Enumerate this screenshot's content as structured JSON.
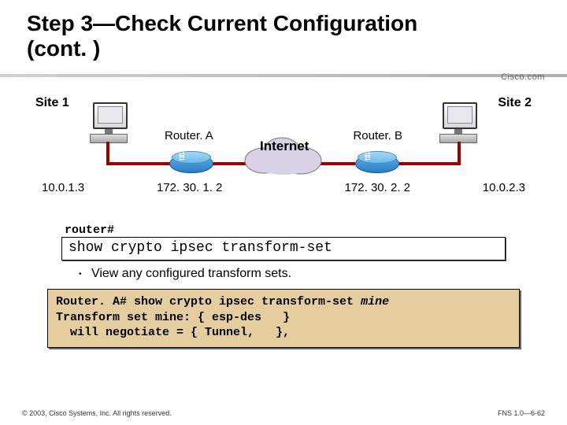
{
  "title_line1": "Step 3—Check Current Configuration",
  "title_line2": "(cont. )",
  "brand": "Cisco.com",
  "diagram": {
    "site1": "Site 1",
    "site2": "Site 2",
    "host1_ip": "10.0.1.3",
    "host2_ip": "10.0.2.3",
    "routerA_label": "Router. A",
    "routerB_label": "Router. B",
    "routerA_ip": "172. 30. 1. 2",
    "routerB_ip": "172. 30. 2. 2",
    "internet": "Internet"
  },
  "cmd": {
    "prompt": "router#",
    "line": "show crypto ipsec transform-set"
  },
  "bullet": "View any configured transform sets.",
  "output": {
    "l1a": "Router. A# show crypto ipsec transform-set ",
    "l1b": "mine",
    "l2": "Transform set mine: { esp-des   }",
    "l3": "  will negotiate = { Tunnel,   },"
  },
  "footer_left": "© 2003, Cisco Systems, Inc. All rights reserved.",
  "footer_right": "FNS 1.0—6-62"
}
